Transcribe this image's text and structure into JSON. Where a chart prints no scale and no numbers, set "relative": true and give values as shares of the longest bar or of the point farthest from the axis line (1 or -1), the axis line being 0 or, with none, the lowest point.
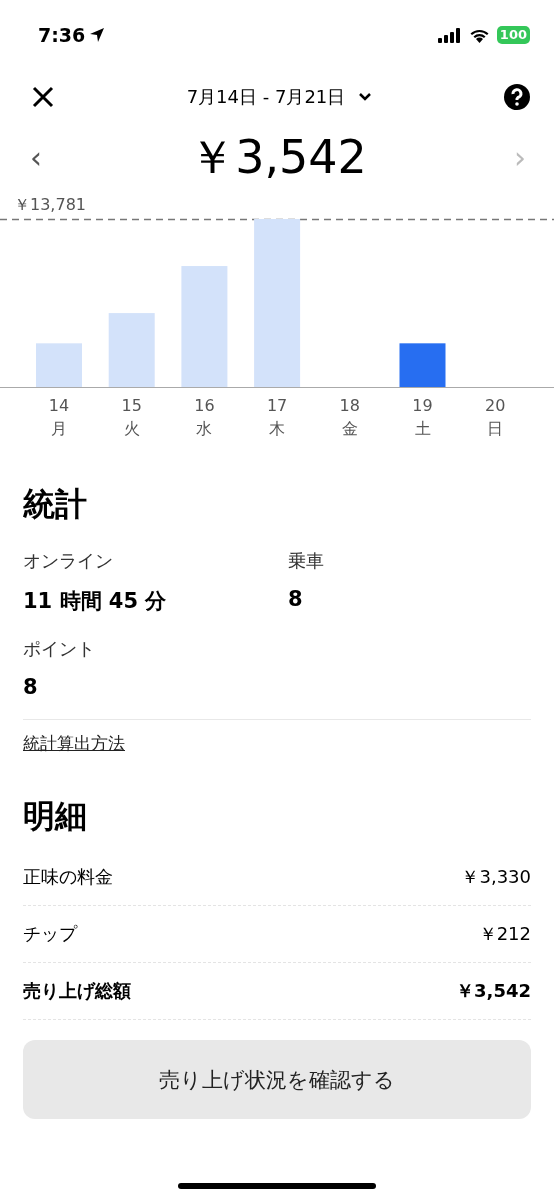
{
  "status_bar": {
    "time": "7:36",
    "battery": "100"
  },
  "header": {
    "date_range": "7月14日 - 7月21日"
  },
  "summary": {
    "amount": "￥3,542",
    "prev_icon": "‹",
    "next_icon": "›",
    "prev_enabled": true,
    "next_enabled": false
  },
  "chart": {
    "max_label": "￥13,781",
    "days": [
      {
        "weekday": "月",
        "selected": false
      },
      {
        "weekday": "火",
        "selected": false
      },
      {
        "weekday": "水",
        "selected": false
      },
      {
        "weekday": "木",
        "selected": false
      },
      {
        "weekday": "金",
        "selected": false
      },
      {
        "weekday": "土",
        "selected": true
      },
      {
        "weekday": "日",
        "selected": false
      }
    ],
    "chart_data": {
      "type": "bar",
      "categories": [
        "14",
        "15",
        "16",
        "17",
        "18",
        "19",
        "20"
      ],
      "relative": true,
      "series": [
        {
          "values": [
            0.26,
            0.44,
            0.72,
            1,
            0,
            0.26,
            0
          ]
        }
      ]
    }
  },
  "stats": {
    "title": "統計",
    "items": [
      {
        "label": "オンライン",
        "value": "11 時間 45 分"
      },
      {
        "label": "乗車",
        "value": "8"
      },
      {
        "label": "ポイント",
        "value": "8"
      }
    ],
    "link": "統計算出方法"
  },
  "breakdown": {
    "title": "明細",
    "rows": [
      {
        "label": "正味の料金",
        "value": "￥3,330",
        "total": false
      },
      {
        "label": "チップ",
        "value": "￥212",
        "total": false
      },
      {
        "label": "売り上げ総額",
        "value": "￥3,542",
        "total": true
      }
    ]
  },
  "button": {
    "label": "売り上げ状況を確認する"
  }
}
